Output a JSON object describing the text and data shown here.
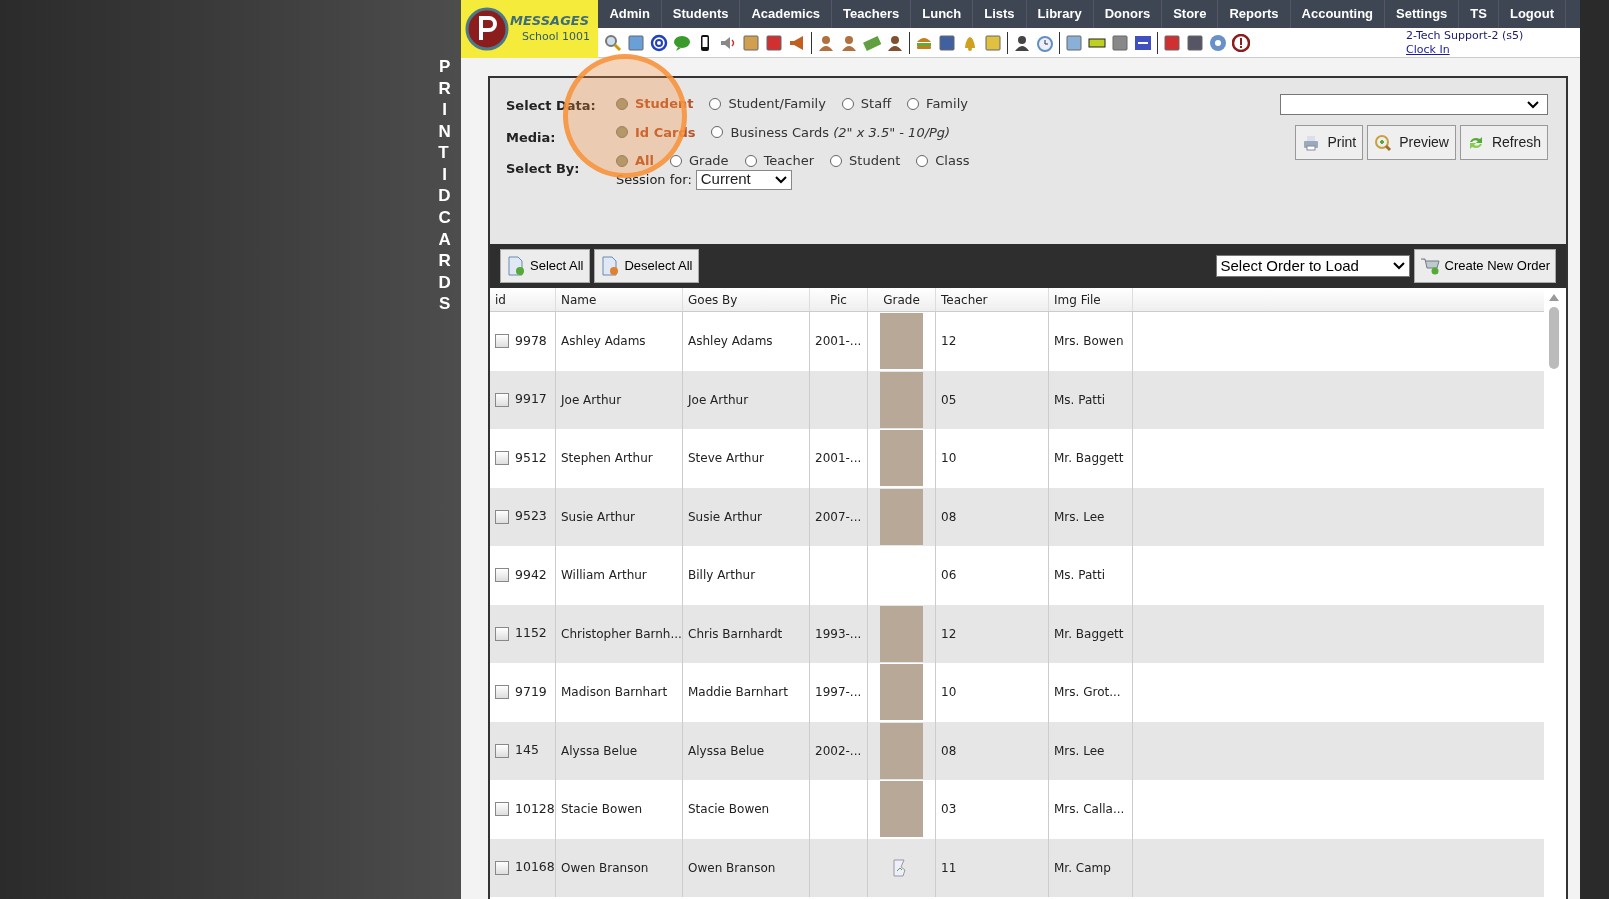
{
  "side_title": "PRINT ID CARDS",
  "logo": {
    "brand": "MESSAGES",
    "school": "School 1001"
  },
  "nav": [
    "Admin",
    "Students",
    "Academics",
    "Teachers",
    "Lunch",
    "Lists",
    "Library",
    "Donors",
    "Store",
    "Reports",
    "Accounting",
    "Settings",
    "TS",
    "Logout"
  ],
  "user": {
    "name": "2-Tech Support-2 (s5)",
    "link": "Clock In"
  },
  "form": {
    "select_data": {
      "label": "Select Data:",
      "options": [
        {
          "label": "Student",
          "selected": true
        },
        {
          "label": "Student/Family",
          "selected": false
        },
        {
          "label": "Staff",
          "selected": false
        },
        {
          "label": "Family",
          "selected": false
        }
      ]
    },
    "media": {
      "label": "Media:",
      "options": [
        {
          "label": "Id Cards",
          "selected": true
        },
        {
          "label": "Business Cards",
          "note": "(2\" x 3.5\" - 10/Pg)",
          "selected": false
        }
      ]
    },
    "select_by": {
      "label": "Select By:",
      "options": [
        {
          "label": "All",
          "selected": true
        },
        {
          "label": "Grade",
          "selected": false
        },
        {
          "label": "Teacher",
          "selected": false
        },
        {
          "label": "Student",
          "selected": false
        },
        {
          "label": "Class",
          "selected": false
        }
      ]
    },
    "session": {
      "label": "Session for:",
      "value": "Current"
    },
    "buttons": [
      "Print",
      "Preview",
      "Refresh"
    ]
  },
  "toolbar": {
    "select_all": "Select All",
    "deselect_all": "Deselect All",
    "order_select": "Select Order to Load",
    "create_order": "Create New Order"
  },
  "table": {
    "columns": [
      "id",
      "Name",
      "Goes By",
      "Pic",
      "Grade",
      "Teacher",
      "Img File"
    ],
    "rows": [
      {
        "checked": false,
        "id": "9978",
        "name": "Ashley Adams",
        "goes_by": "Ashley Adams",
        "date": "2001-...",
        "kind": "photo",
        "grade": "12",
        "teacher": "Mrs. Bowen"
      },
      {
        "checked": false,
        "id": "9917",
        "name": "Joe Arthur",
        "goes_by": "Joe Arthur",
        "date": "",
        "kind": "photo",
        "grade": "05",
        "teacher": "Ms. Patti"
      },
      {
        "checked": false,
        "id": "9512",
        "name": "Stephen Arthur",
        "goes_by": "Steve Arthur",
        "date": "2001-...",
        "kind": "photo",
        "grade": "10",
        "teacher": "Mr. Baggett"
      },
      {
        "checked": false,
        "id": "9523",
        "name": "Susie Arthur",
        "goes_by": "Susie Arthur",
        "date": "2007-...",
        "kind": "photo",
        "grade": "08",
        "teacher": "Mrs. Lee"
      },
      {
        "checked": false,
        "id": "9942",
        "name": "William Arthur",
        "goes_by": "Billy Arthur",
        "date": "",
        "kind": "empty",
        "grade": "06",
        "teacher": "Ms. Patti"
      },
      {
        "checked": false,
        "id": "1152",
        "name": "Christopher Barnh...",
        "goes_by": "Chris Barnhardt",
        "date": "1993-...",
        "kind": "photo",
        "grade": "12",
        "teacher": "Mr. Baggett"
      },
      {
        "checked": false,
        "id": "9719",
        "name": "Madison Barnhart",
        "goes_by": "Maddie Barnhart",
        "date": "1997-...",
        "kind": "photo",
        "grade": "10",
        "teacher": "Mrs. Grot..."
      },
      {
        "checked": false,
        "id": "145",
        "name": "Alyssa Belue",
        "goes_by": "Alyssa Belue",
        "date": "2002-...",
        "kind": "photo",
        "grade": "08",
        "teacher": "Mrs. Lee"
      },
      {
        "checked": false,
        "id": "10128",
        "name": "Stacie Bowen",
        "goes_by": "Stacie Bowen",
        "date": "",
        "kind": "photo",
        "grade": "03",
        "teacher": "Mrs. Calla..."
      },
      {
        "checked": false,
        "id": "10168",
        "name": "Owen Branson",
        "goes_by": "Owen Branson",
        "date": "",
        "kind": "broken",
        "grade": "11",
        "teacher": "Mr. Camp"
      }
    ]
  }
}
